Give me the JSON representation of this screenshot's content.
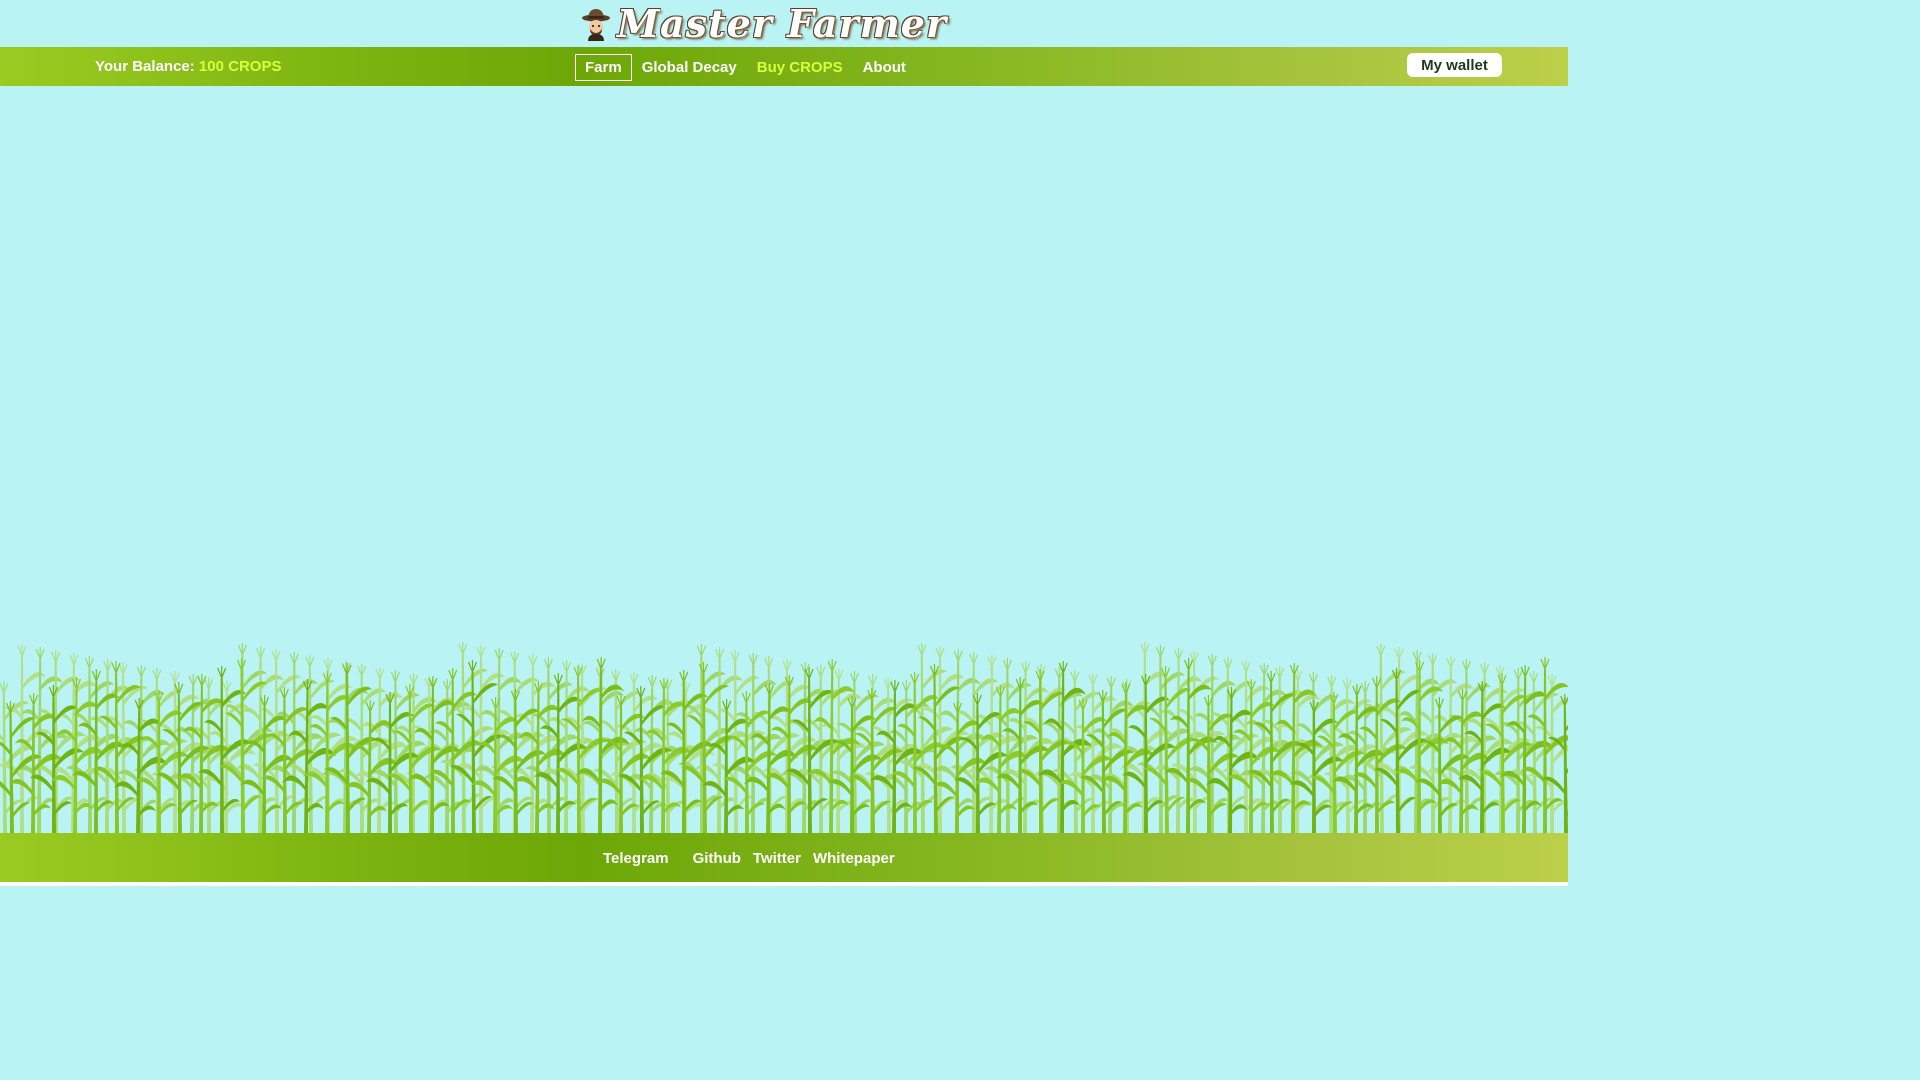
{
  "header": {
    "logo_text": "Master Farmer",
    "logo_icon": "farmer-icon"
  },
  "navbar": {
    "balance_label": "Your Balance:",
    "balance_amount": "100 CROPS",
    "links": [
      {
        "label": "Farm",
        "active": true
      },
      {
        "label": "Global Decay",
        "active": false
      },
      {
        "label": "Buy CROPS",
        "active": false
      },
      {
        "label": "About",
        "active": false
      }
    ],
    "wallet_label": "My wallet"
  },
  "footer": {
    "links": [
      "Telegram",
      "Github",
      "Twitter",
      "Whitepaper"
    ]
  },
  "colors": {
    "background": "#b9f3f3",
    "nav_green": "#7ab10e",
    "accent_yellow": "#d7ff3d",
    "corn_green": "#7fbf1f"
  }
}
